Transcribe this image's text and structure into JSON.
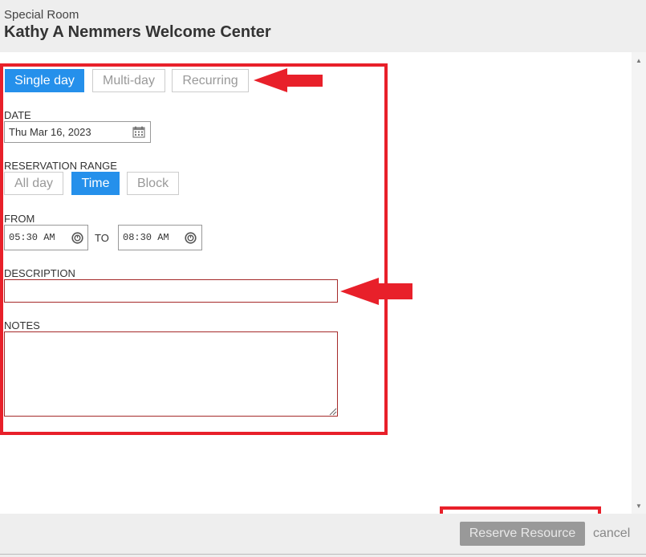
{
  "header": {
    "subtitle": "Special Room",
    "title": "Kathy A Nemmers Welcome Center"
  },
  "mode_tabs": [
    {
      "label": "Single day",
      "active": true
    },
    {
      "label": "Multi-day",
      "active": false
    },
    {
      "label": "Recurring",
      "active": false
    }
  ],
  "date": {
    "label": "DATE",
    "value": "Thu Mar 16, 2023"
  },
  "range": {
    "label": "RESERVATION RANGE",
    "options": [
      {
        "label": "All day",
        "active": false
      },
      {
        "label": "Time",
        "active": true
      },
      {
        "label": "Block",
        "active": false
      }
    ]
  },
  "time": {
    "from_label": "FROM",
    "from_value": "05:30 AM",
    "to_label": "TO",
    "to_value": "08:30 AM"
  },
  "description": {
    "label": "DESCRIPTION",
    "value": ""
  },
  "notes": {
    "label": "NOTES",
    "value": ""
  },
  "footer": {
    "reserve_label": "Reserve Resource",
    "cancel_label": "cancel"
  },
  "colors": {
    "accent": "#2590eb",
    "annotation_red": "#e8202a",
    "invalid_border": "#a52a2a"
  },
  "icons": [
    "calendar-icon",
    "clock-icon",
    "arrow-left-icon"
  ]
}
